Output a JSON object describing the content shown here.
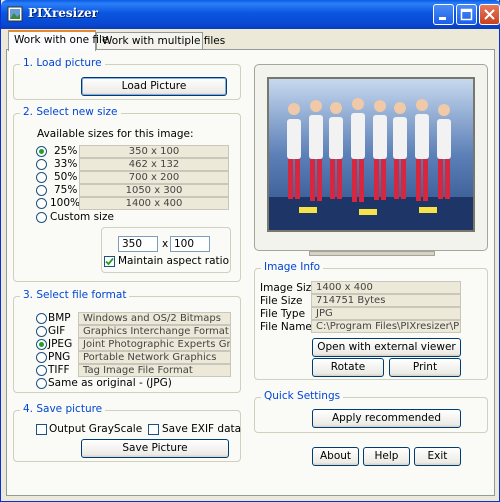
{
  "window": {
    "title": "PIXresizer"
  },
  "tabs": [
    "Work with one file",
    "Work with multiple files"
  ],
  "load": {
    "group_title": "1. Load picture",
    "button": "Load Picture"
  },
  "size": {
    "group_title": "2. Select new size",
    "available_label": "Available sizes for this image:",
    "options": [
      {
        "percent": "25%",
        "dims": "350 x 100",
        "checked": true
      },
      {
        "percent": "33%",
        "dims": "462 x 132",
        "checked": false
      },
      {
        "percent": "50%",
        "dims": "700 x 200",
        "checked": false
      },
      {
        "percent": "75%",
        "dims": "1050 x 300",
        "checked": false
      },
      {
        "percent": "100%",
        "dims": "1400 x 400",
        "checked": false
      }
    ],
    "custom_label": "Custom size",
    "width_value": "350",
    "x_label": "x",
    "height_value": "100",
    "maintain_label": "Maintain aspect ratio",
    "maintain_checked": true
  },
  "format": {
    "group_title": "3. Select file format",
    "options": [
      {
        "name": "BMP",
        "desc": "Windows and OS/2 Bitmaps",
        "checked": false
      },
      {
        "name": "GIF",
        "desc": "Graphics Interchange Format",
        "checked": false
      },
      {
        "name": "JPEG",
        "desc": "Joint Photographic Experts Group",
        "checked": true
      },
      {
        "name": "PNG",
        "desc": "Portable Network Graphics",
        "checked": false
      },
      {
        "name": "TIFF",
        "desc": "Tag Image File Format",
        "checked": false
      }
    ],
    "same_label": "Same as original  - (JPG)"
  },
  "save": {
    "group_title": "4. Save picture",
    "grayscale_label": "Output GrayScale",
    "exif_label": "Save EXIF data",
    "button": "Save Picture"
  },
  "info": {
    "group_title": "Image Info",
    "rows": [
      {
        "label": "Image Size",
        "value": "1400 x 400"
      },
      {
        "label": "File Size",
        "value": "714751 Bytes"
      },
      {
        "label": "File Type",
        "value": "JPG"
      },
      {
        "label": "File Name",
        "value": "C:\\Program Files\\PIXresizer\\PIXresiz"
      }
    ],
    "open_button": "Open with external viewer",
    "rotate_button": "Rotate",
    "print_button": "Print"
  },
  "quick": {
    "group_title": "Quick Settings",
    "apply_button": "Apply recommended"
  },
  "footer": {
    "about": "About",
    "help": "Help",
    "exit": "Exit"
  },
  "colors": {
    "accent": "#0046d5",
    "titlebar": "#0a56e0",
    "selected_radio": "#21a121"
  },
  "icons": [
    "app-icon",
    "minimize-icon",
    "maximize-icon",
    "close-icon",
    "check-icon"
  ]
}
